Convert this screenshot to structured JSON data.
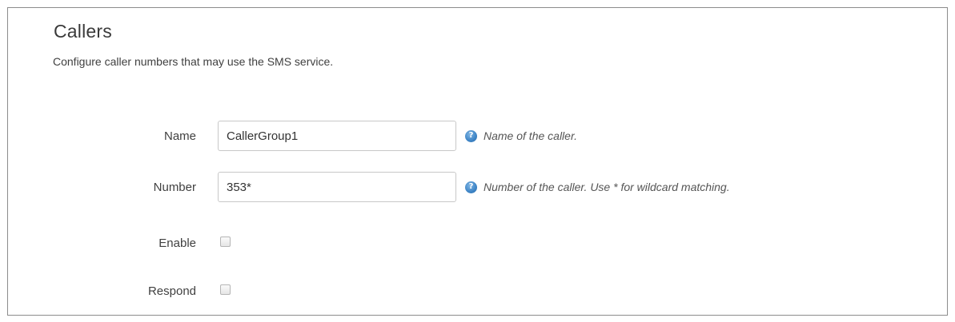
{
  "section": {
    "title": "Callers",
    "description": "Configure caller numbers that may use the SMS service."
  },
  "fields": {
    "name": {
      "label": "Name",
      "value": "CallerGroup1",
      "help": "Name of the caller."
    },
    "number": {
      "label": "Number",
      "value": "353*",
      "help": "Number of the caller. Use * for wildcard matching."
    },
    "enable": {
      "label": "Enable",
      "checked": false
    },
    "respond": {
      "label": "Respond",
      "checked": false
    }
  },
  "icons": {
    "help": "help-icon",
    "help_glyph": "?"
  },
  "colors": {
    "help_icon": "#3d84c6",
    "border": "#8c8c8c"
  }
}
